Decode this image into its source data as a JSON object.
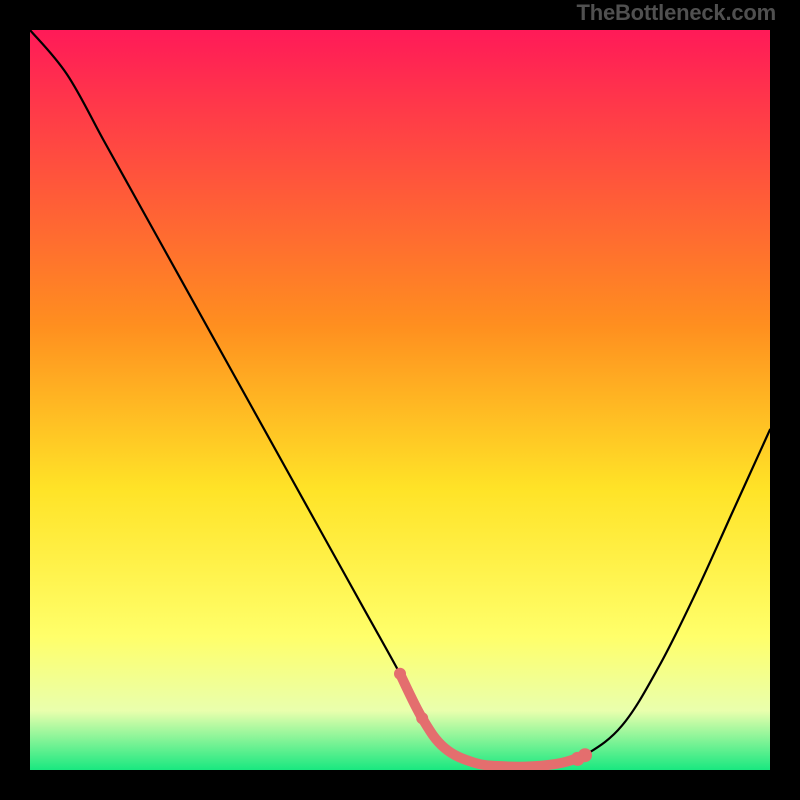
{
  "watermark": "TheBottleneck.com",
  "chart_data": {
    "type": "line",
    "title": "",
    "xlabel": "",
    "ylabel": "",
    "xlim": [
      0,
      100
    ],
    "ylim": [
      0,
      100
    ],
    "background_gradient": {
      "top": "#ff1a58",
      "upper_mid": "#ffd000",
      "lower_mid": "#ffff6a",
      "near_bottom": "#e9ffad",
      "bottom": "#19e880"
    },
    "series": [
      {
        "name": "bottleneck-curve",
        "x": [
          0,
          5,
          10,
          15,
          20,
          25,
          30,
          35,
          40,
          45,
          50,
          53,
          56,
          60,
          64,
          68,
          72,
          75,
          80,
          85,
          90,
          95,
          100
        ],
        "y": [
          100,
          94,
          85,
          76,
          67,
          58,
          49,
          40,
          31,
          22,
          13,
          7,
          3,
          1,
          0.5,
          0.5,
          1,
          2,
          6,
          14,
          24,
          35,
          46
        ],
        "color": "#000000"
      }
    ],
    "highlight_segment": {
      "name": "optimal-range",
      "x": [
        50,
        53,
        56,
        60,
        64,
        68,
        72,
        75
      ],
      "y": [
        13,
        7,
        3,
        1,
        0.5,
        0.5,
        1,
        2
      ],
      "color": "#e46e6e",
      "stroke_width": 10
    },
    "highlight_points": [
      {
        "x": 50,
        "y": 13,
        "r": 6,
        "color": "#e46e6e"
      },
      {
        "x": 53,
        "y": 7,
        "r": 6,
        "color": "#e46e6e"
      },
      {
        "x": 75,
        "y": 2,
        "r": 7,
        "color": "#e46e6e"
      },
      {
        "x": 74,
        "y": 1.5,
        "r": 7,
        "color": "#e46e6e"
      }
    ]
  }
}
